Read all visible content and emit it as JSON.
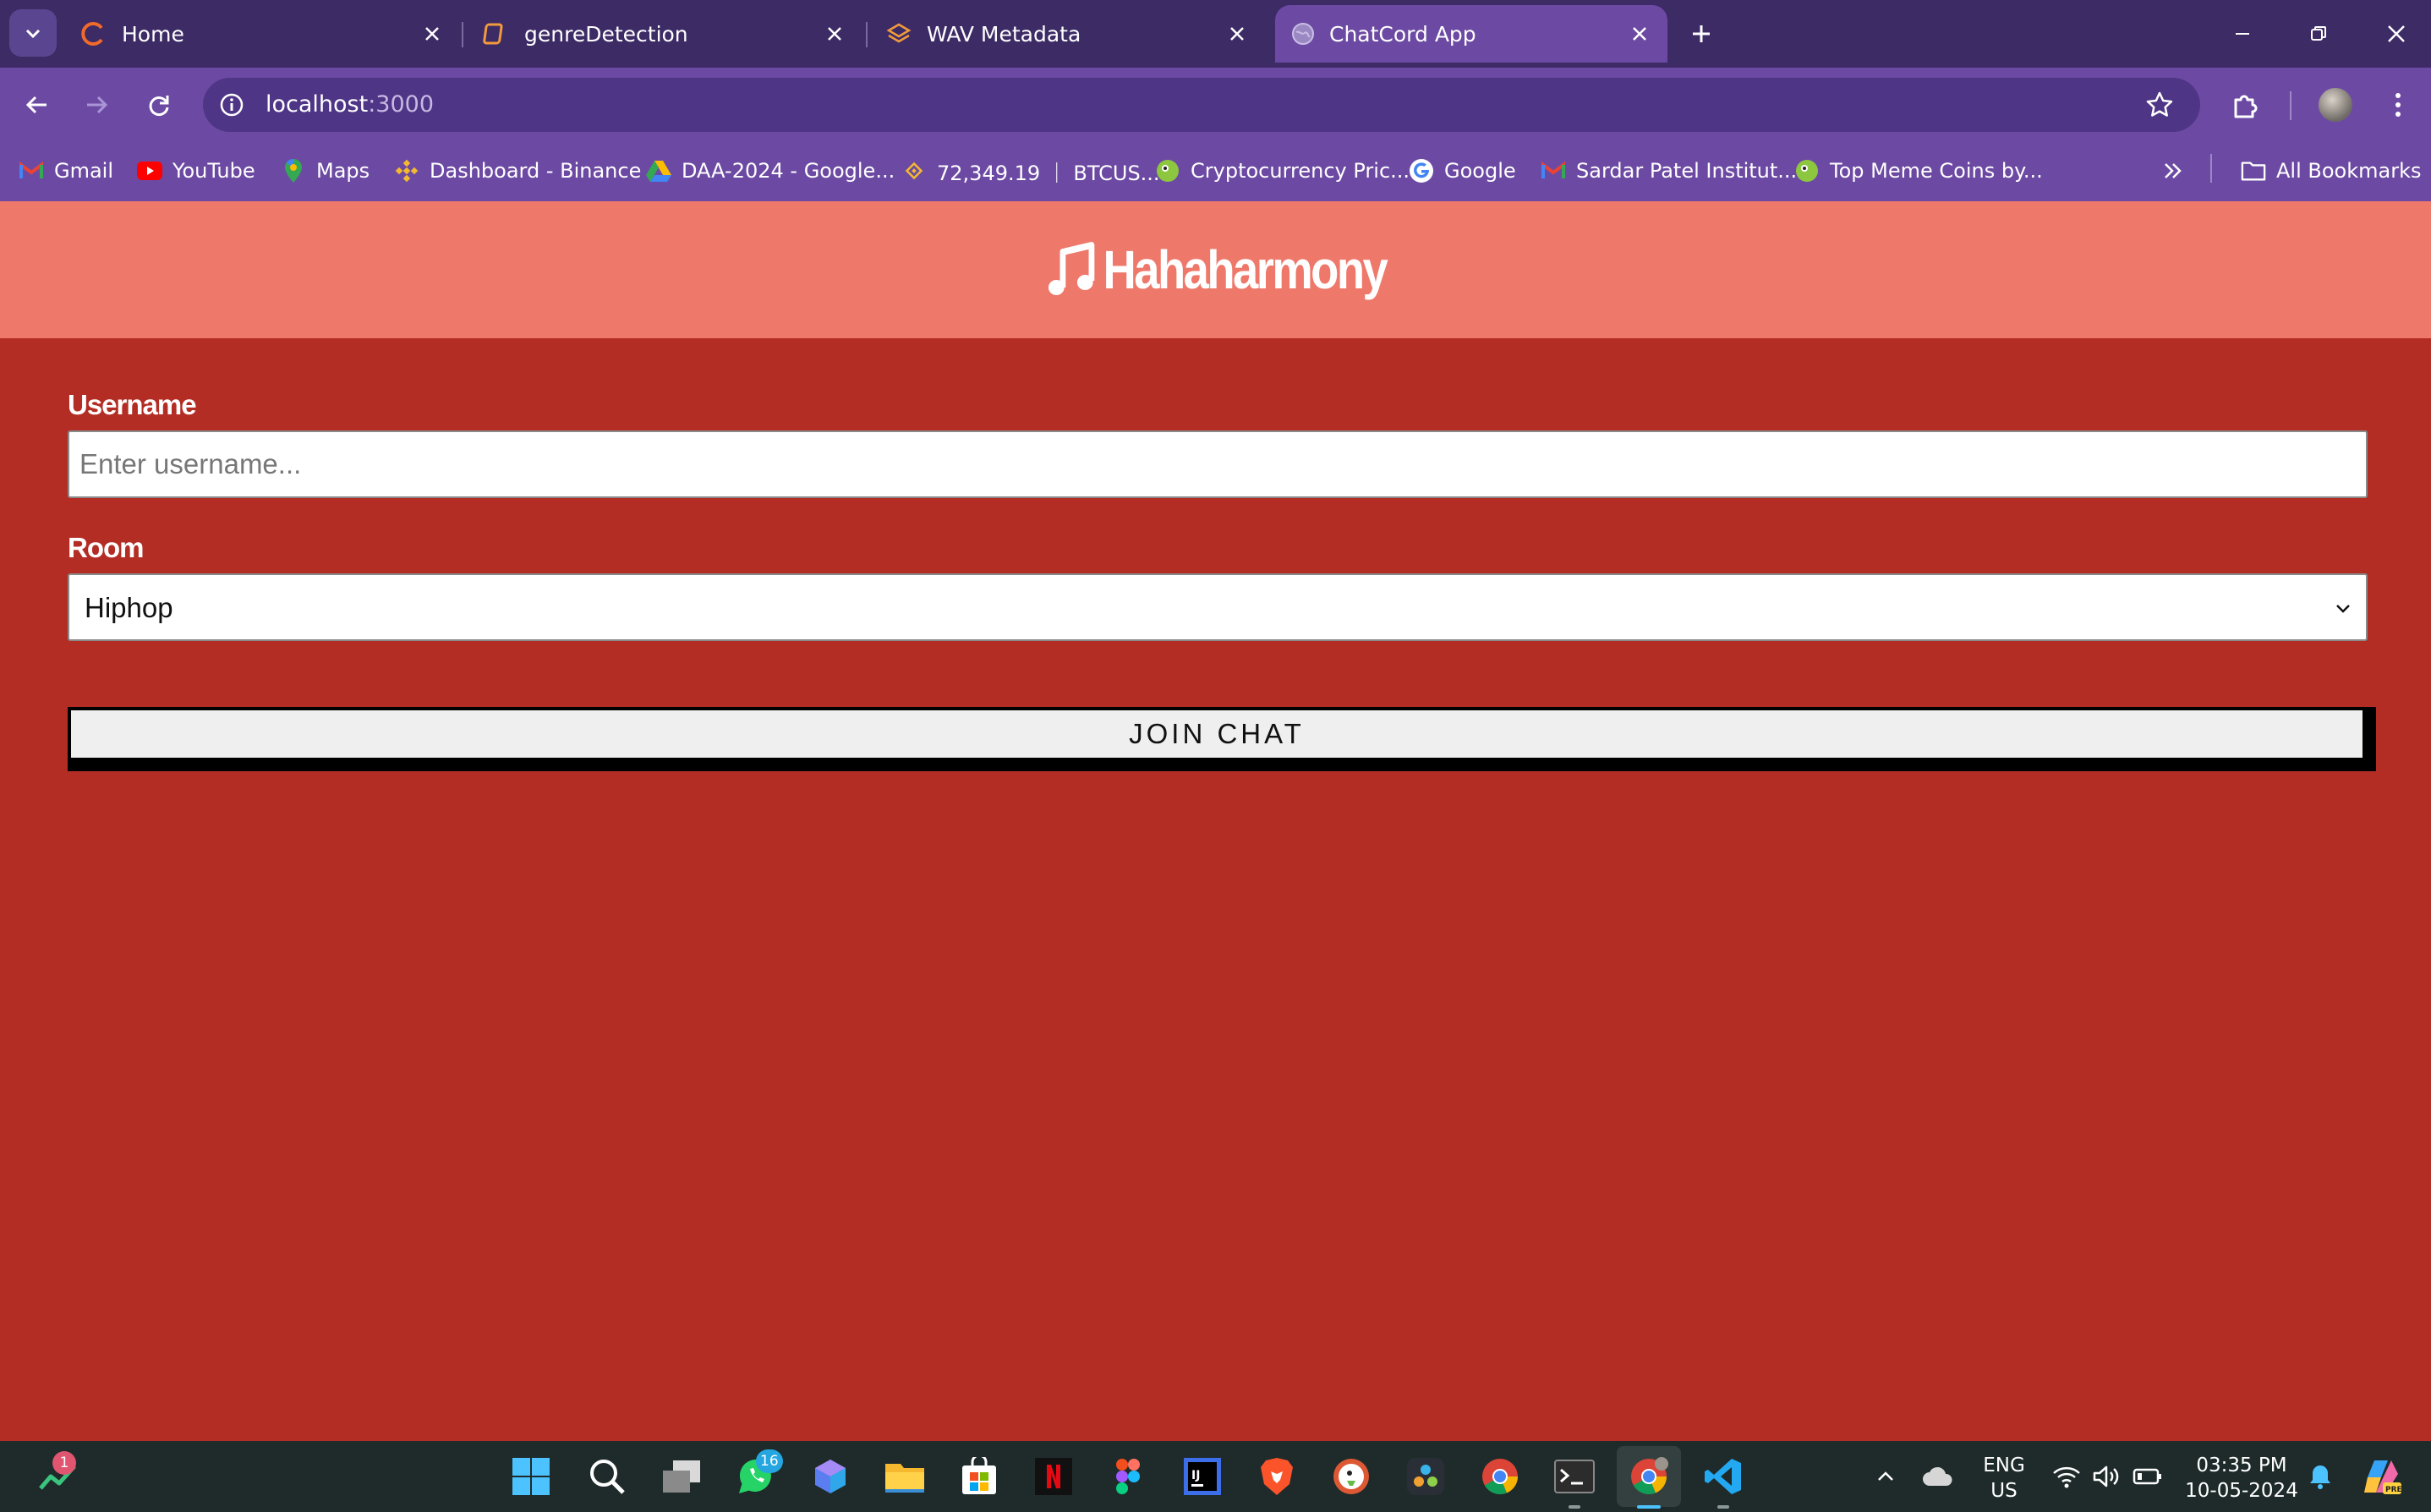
{
  "browser": {
    "tabs": [
      {
        "title": "Home",
        "icon": "circle-logo-icon"
      },
      {
        "title": "genreDetection",
        "icon": "notebook-icon"
      },
      {
        "title": "WAV Metadata",
        "icon": "layers-icon"
      },
      {
        "title": "ChatCord App",
        "icon": "globe-icon",
        "active": true
      }
    ],
    "url_host": "localhost",
    "url_port": ":3000",
    "bookmarks": [
      {
        "label": "Gmail",
        "icon": "gmail-icon"
      },
      {
        "label": "YouTube",
        "icon": "youtube-icon"
      },
      {
        "label": "Maps",
        "icon": "maps-icon"
      },
      {
        "label": "Dashboard - Binance",
        "icon": "binance-icon"
      },
      {
        "label": "DAA-2024 - Google...",
        "icon": "drive-icon"
      },
      {
        "label": "72,349.19 ｜ BTCUS...",
        "icon": "binance-icon"
      },
      {
        "label": "Cryptocurrency Pric...",
        "icon": "coin-icon"
      },
      {
        "label": "Google",
        "icon": "google-icon"
      },
      {
        "label": "Sardar Patel Institut...",
        "icon": "gmail-icon"
      },
      {
        "label": "Top Meme Coins by...",
        "icon": "coin-icon"
      }
    ],
    "all_bookmarks": "All Bookmarks"
  },
  "app": {
    "brand": "Hahaharmony",
    "username_label": "Username",
    "username_placeholder": "Enter username...",
    "room_label": "Room",
    "room_selected": "Hiphop",
    "join_button": "JOIN CHAT"
  },
  "taskbar": {
    "stocks_badge": "1",
    "whatsapp_badge": "16",
    "lang_line1": "ENG",
    "lang_line2": "US",
    "time": "03:35 PM",
    "date": "10-05-2024"
  },
  "colors": {
    "page_background": "#b32d25",
    "header_background": "#ee786a",
    "browser_chrome": "#6c4aa3"
  }
}
